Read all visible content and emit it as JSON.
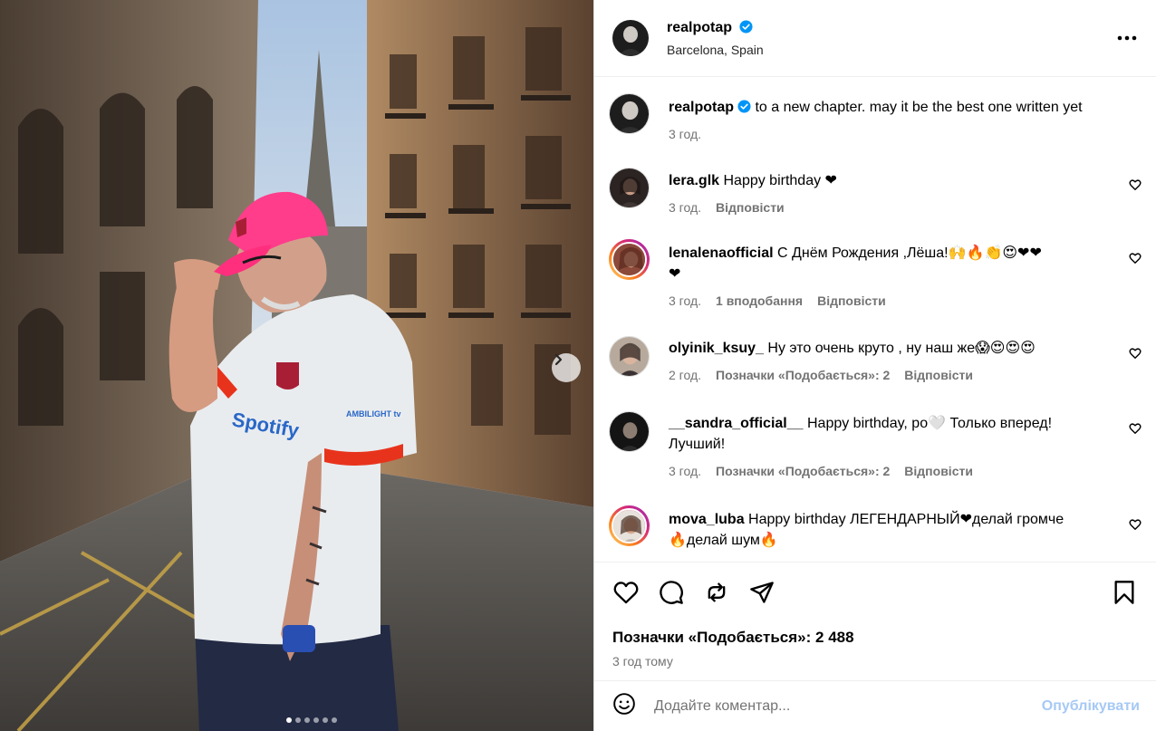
{
  "photo": {
    "carousel_count": 6,
    "active_index": 0,
    "next_label": "next"
  },
  "header": {
    "username": "realpotap",
    "location": "Barcelona, Spain",
    "more": "•••"
  },
  "caption": {
    "username": "realpotap",
    "text": "to a new chapter. may it be the best one written yet",
    "time": "3 год."
  },
  "comments": [
    {
      "username": "lera.glk",
      "text": "Happy birthday ❤",
      "time": "3 год.",
      "likes": "",
      "reply": "Відповісти"
    },
    {
      "username": "lenalenaofficial",
      "text": "С Днём Рождения ,Лёша!🙌🔥👏😍❤❤",
      "text2": "❤",
      "time": "3 год.",
      "likes": "1 вподобання",
      "reply": "Відповісти"
    },
    {
      "username": "olyinik_ksuy_",
      "text": "Ну это очень круто , ну наш же😱😍😍😍",
      "time": "2 год.",
      "likes": "Позначки «Подобається»: 2",
      "reply": "Відповісти"
    },
    {
      "username": "__sandra_official__",
      "text": "Happy birthday, ро🤍 Только вперед!",
      "text2": "Лучший!",
      "time": "3 год.",
      "likes": "Позначки «Подобається»: 2",
      "reply": "Відповісти"
    },
    {
      "username": "mova_luba",
      "text": "Happy birthday ЛЕГЕНДАРНЫЙ❤делай громче",
      "text2": "🔥делай шум🔥",
      "time": "",
      "likes": "",
      "reply": ""
    }
  ],
  "actions": {
    "likes": "Позначки «Подобається»: 2 488",
    "time": "3 год тому"
  },
  "add_comment": {
    "placeholder": "Додайте коментар...",
    "post_label": "Опублікувати"
  },
  "colors": {
    "verified": "#0095f6",
    "heart": "#e0245e",
    "post_button_disabled": "#a6c9f5",
    "muted": "#737373"
  }
}
